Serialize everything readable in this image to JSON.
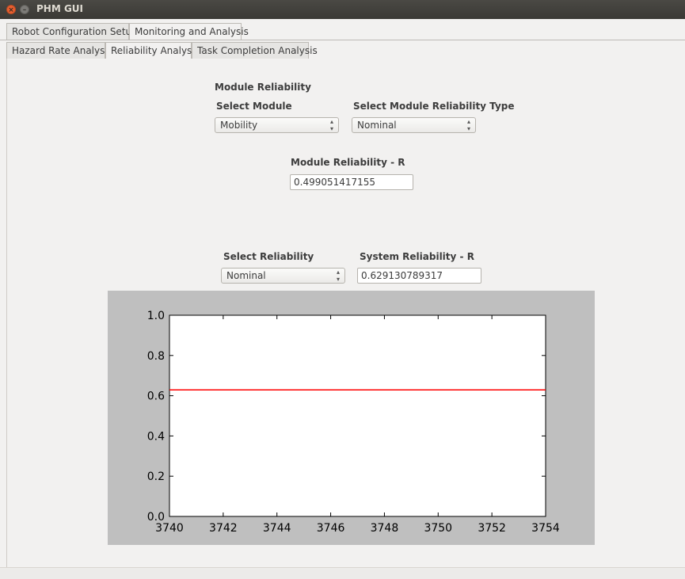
{
  "window": {
    "title": "PHM GUI"
  },
  "main_tabs": [
    {
      "label": "Robot Configuration Setup",
      "active": false
    },
    {
      "label": "Monitoring and Analysis",
      "active": true
    }
  ],
  "sub_tabs": [
    {
      "label": "Hazard Rate Analysis",
      "active": false
    },
    {
      "label": "Reliability Analysis",
      "active": true
    },
    {
      "label": "Task Completion Analysis",
      "active": false
    }
  ],
  "module_section": {
    "heading": "Module Reliability",
    "select_module_label": "Select Module",
    "select_module_value": "Mobility",
    "select_type_label": "Select Module Reliability Type",
    "select_type_value": "Nominal",
    "module_reliability_label": "Module Reliability - R",
    "module_reliability_value": "0.499051417155"
  },
  "system_section": {
    "select_reliability_label": "Select Reliability",
    "select_reliability_value": "Nominal",
    "system_reliability_label": "System Reliability - R",
    "system_reliability_value": "0.629130789317"
  },
  "chart_data": {
    "type": "line",
    "title": "",
    "xlabel": "",
    "ylabel": "",
    "xlim": [
      3740,
      3754
    ],
    "ylim": [
      0.0,
      1.0
    ],
    "x_ticks": [
      "3740",
      "3742",
      "3744",
      "3746",
      "3748",
      "3750",
      "3752",
      "3754"
    ],
    "y_ticks": [
      "0.0",
      "0.2",
      "0.4",
      "0.6",
      "0.8",
      "1.0"
    ],
    "grid": false,
    "series": [
      {
        "color": "#ff0000",
        "x": [
          3740,
          3754
        ],
        "y": [
          0.6291,
          0.6291
        ]
      }
    ]
  }
}
